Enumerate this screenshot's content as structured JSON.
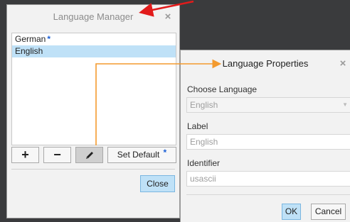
{
  "language_manager": {
    "title": "Language Manager",
    "close_icon": "×",
    "languages": [
      {
        "label": "German",
        "marker": "*",
        "selected": false
      },
      {
        "label": "English",
        "marker": "",
        "selected": true
      }
    ],
    "toolbar": {
      "add_label": "+",
      "remove_label": "−",
      "edit_icon": "pencil-icon",
      "set_default_label": "Set Default",
      "set_default_marker": "*"
    },
    "close_button_label": "Close"
  },
  "language_properties": {
    "title": "Language Properties",
    "close_icon": "×",
    "choose_language_label": "Choose Language",
    "choose_language_value": "English",
    "label_label": "Label",
    "label_value": "English",
    "identifier_label": "Identifier",
    "identifier_value": "usascii",
    "ok_label": "OK",
    "cancel_label": "Cancel"
  },
  "colors": {
    "accent": "#bfe1f7",
    "annotation_red": "#e21b1b",
    "annotation_orange": "#f39a2e",
    "default_marker": "#1a5fd6"
  }
}
